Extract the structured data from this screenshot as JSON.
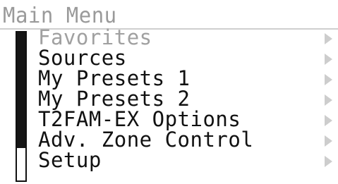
{
  "screen": {
    "title": "Main Menu",
    "scroll_position": 0.78,
    "items": [
      {
        "label": "Favorites",
        "dim": true,
        "arrow_icon": "chevron-right-icon"
      },
      {
        "label": "Sources",
        "dim": false,
        "arrow_icon": "chevron-right-icon"
      },
      {
        "label": "My Presets 1",
        "dim": false,
        "arrow_icon": "chevron-right-icon"
      },
      {
        "label": "My Presets 2",
        "dim": false,
        "arrow_icon": "chevron-right-icon"
      },
      {
        "label": "T2FAM-EX Options",
        "dim": false,
        "arrow_icon": "chevron-right-icon"
      },
      {
        "label": "Adv. Zone Control",
        "dim": false,
        "arrow_icon": "chevron-right-icon"
      },
      {
        "label": "Setup",
        "dim": false,
        "arrow_icon": "chevron-right-icon"
      }
    ]
  },
  "colors": {
    "text": "#111111",
    "dim_text": "#a0a0a0",
    "title_text": "#9a9a9a",
    "arrow": "#cdcdcd",
    "scrollbar": "#151515"
  }
}
